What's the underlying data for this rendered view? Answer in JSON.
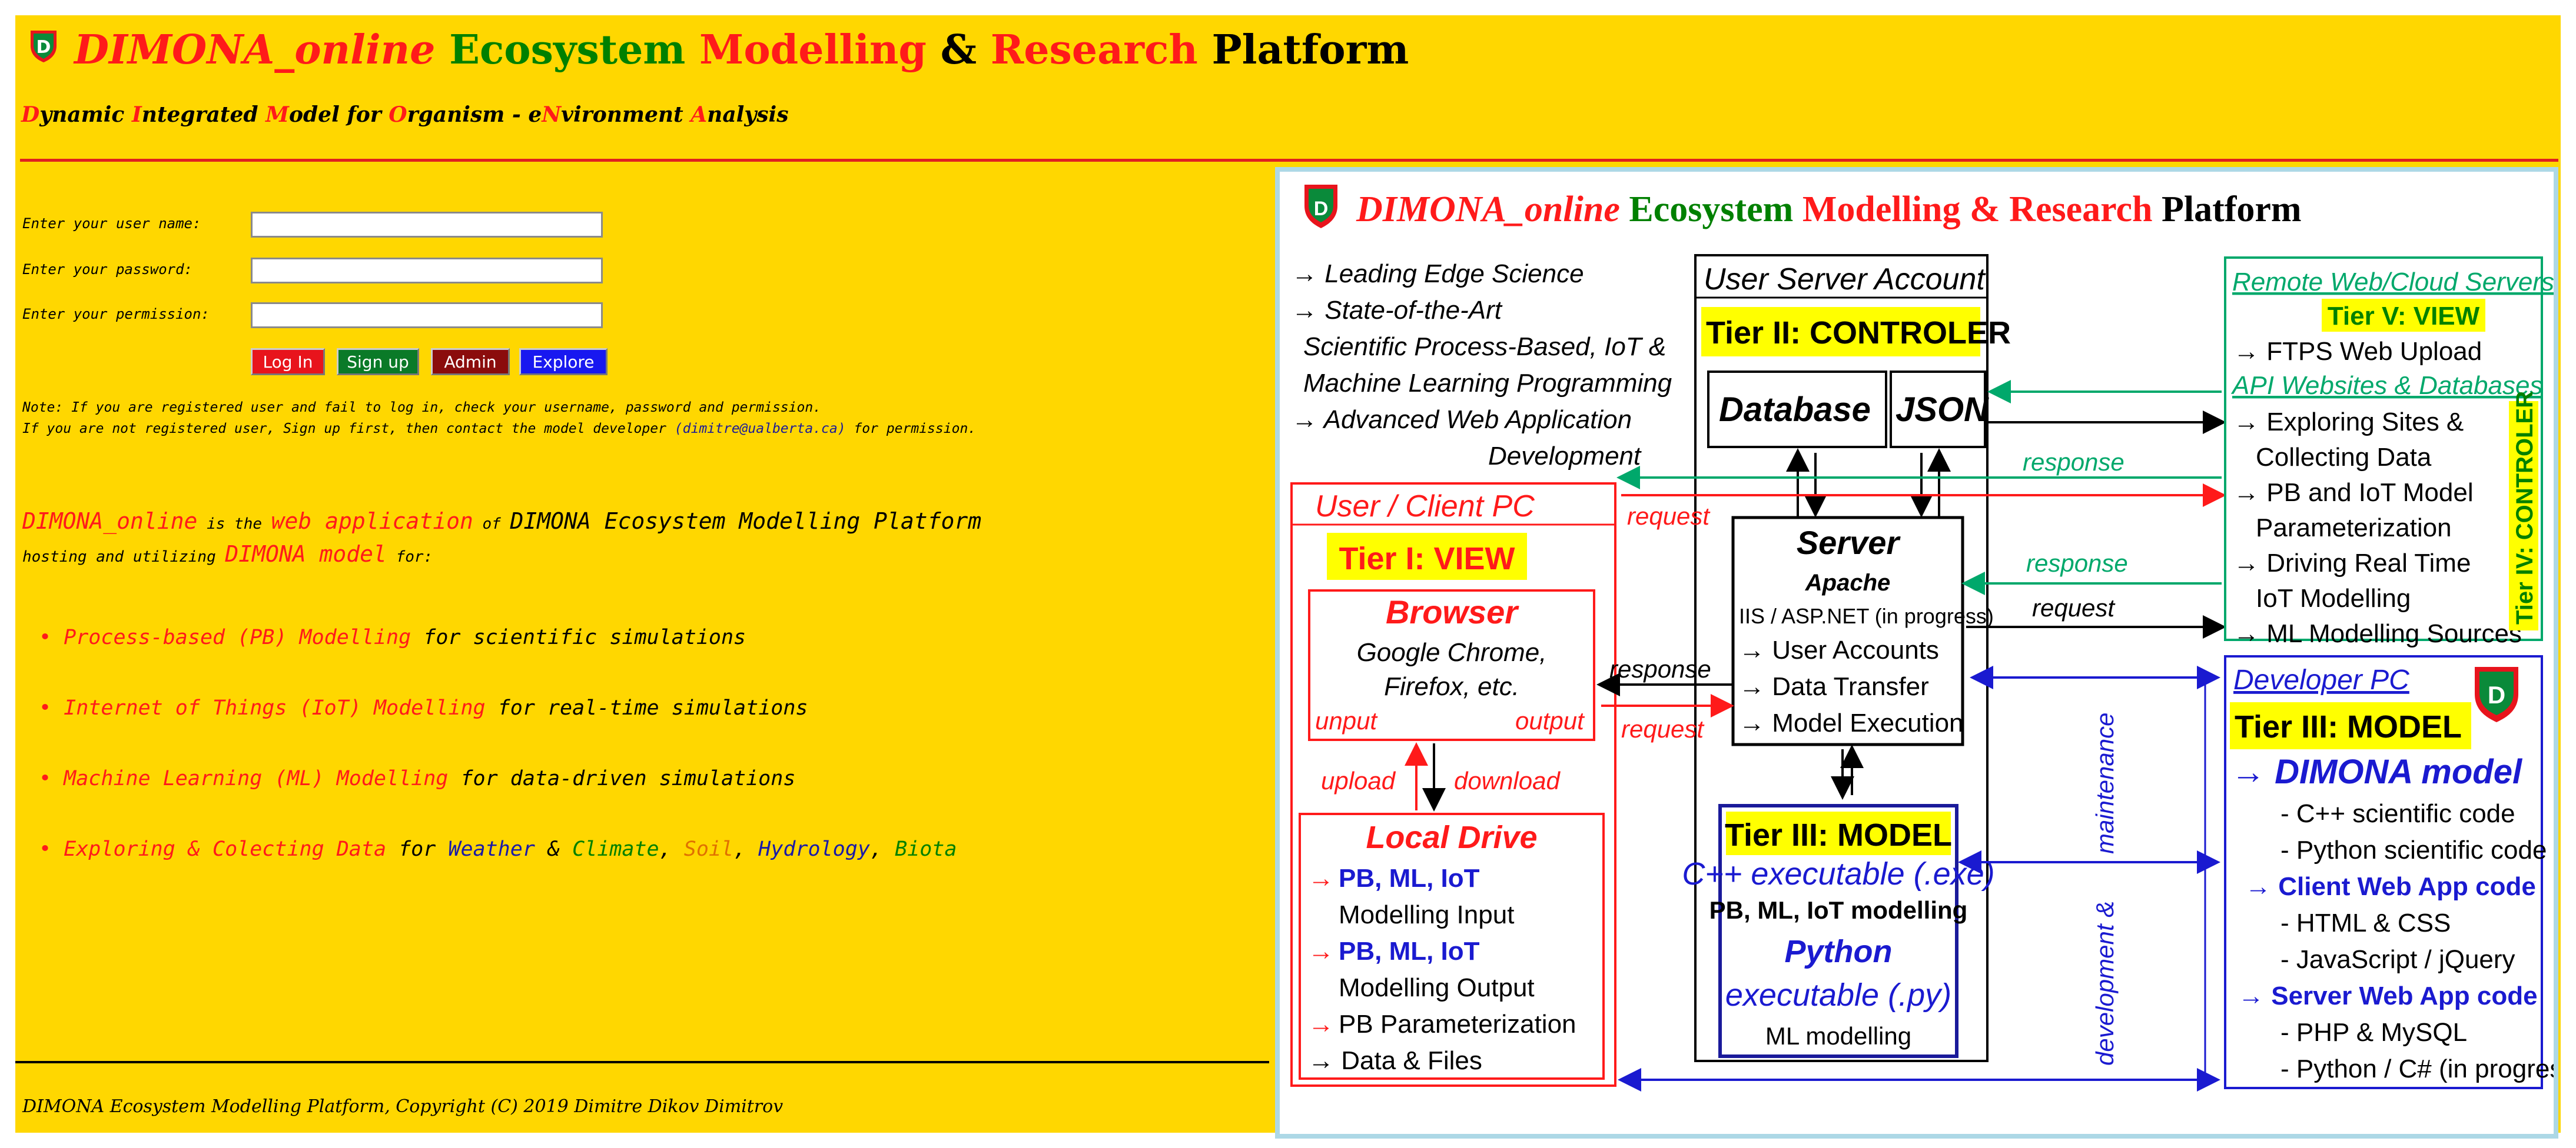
{
  "header": {
    "title": {
      "part1": "DIMONA_online",
      "part2": "Ecosystem",
      "part3": "Modelling",
      "part4": "&",
      "part5": "Research",
      "part6": "Platform"
    },
    "logo_letter": "D",
    "subtitle": [
      {
        "text": "D",
        "color": "red"
      },
      {
        "text": "ynamic ",
        "color": "black"
      },
      {
        "text": "I",
        "color": "red"
      },
      {
        "text": "ntegrated ",
        "color": "black"
      },
      {
        "text": "M",
        "color": "red"
      },
      {
        "text": "odel for ",
        "color": "black"
      },
      {
        "text": "O",
        "color": "red"
      },
      {
        "text": "rganism - e",
        "color": "black"
      },
      {
        "text": "N",
        "color": "red"
      },
      {
        "text": "vironment ",
        "color": "black"
      },
      {
        "text": "A",
        "color": "red"
      },
      {
        "text": "nalysis",
        "color": "black"
      }
    ]
  },
  "login": {
    "username_label": "Enter your user name:",
    "password_label": "Enter your password:",
    "permission_label": "Enter your permission:",
    "username_value": "",
    "password_value": "",
    "permission_value": "",
    "buttons": {
      "login": "Log In",
      "signup": "Sign up",
      "admin": "Admin",
      "explore": "Explore"
    },
    "note_line1": "Note: If you are registered user and fail to log in, check your username, password and permission.",
    "note_line2_pre": "If you are not registered user, Sign up first, then contact the model developer ",
    "note_email": "(dimitre@ualberta.ca)",
    "note_line2_post": " for permission."
  },
  "intro": {
    "app": "DIMONA_online",
    "is_the": " is the ",
    "webapp": "web application",
    "of": " of ",
    "platform": "DIMONA Ecosystem Modelling Platform",
    "hosting": "hosting and utilizing ",
    "model": "DIMONA model",
    "for": " for:"
  },
  "bullets": [
    {
      "head": "Process-based (PB) Modelling",
      "tail": " for scientific simulations"
    },
    {
      "head": "Internet of Things (IoT) Modelling",
      "tail": " for real-time simulations"
    },
    {
      "head": "Machine Learning (ML) Modelling",
      "tail": " for data-driven simulations"
    }
  ],
  "explore_bullet": {
    "head": "Exploring & Colecting Data",
    "for": " for ",
    "weather": "Weather",
    "amp": " & ",
    "climate": "Climate",
    "c1": ", ",
    "soil": "Soil",
    "c2": ", ",
    "hydrology": "Hydrology",
    "c3": ", ",
    "biota": "Biota"
  },
  "footer": "DIMONA Ecosystem Modelling Platform, Copyright (C) 2019 Dimitre Dikov Dimitrov",
  "diagram": {
    "title": {
      "part1": "DIMONA_online",
      "part2": "Ecosystem",
      "part3": "Modelling",
      "part4": "&",
      "part5": "Research",
      "part6": "Platform"
    },
    "features": [
      "→  Leading Edge Science",
      "→  State-of-the-Art",
      "Scientific Process-Based, IoT &",
      "Machine Learning Programming",
      "→  Advanced Web Application",
      "Development"
    ],
    "user_server_account": "User Server Account",
    "tier2": "Tier II: CONTROLER",
    "database": "Database",
    "json": "JSON",
    "server": "Server",
    "apache": "Apache",
    "iis": "IIS / ASP.NET (in progress)",
    "server_items": [
      "→ User Accounts",
      "→ Data Transfer",
      "→ Model Execution"
    ],
    "client_pc": "User / Client PC",
    "tier1": "Tier I: VIEW",
    "browser": "Browser",
    "browser_desc1": "Google Chrome,",
    "browser_desc2": "Firefox, etc.",
    "unput": "unput",
    "output": "output",
    "upload": "upload",
    "download": "download",
    "local_drive": "Local Drive",
    "local_items": [
      "PB, ML, IoT",
      "Modelling Input",
      "PB, ML, IoT",
      "Modelling Output",
      "PB Parameterization",
      "→ Data & Files"
    ],
    "tier3_center": "Tier III: MODEL",
    "cpp_exe": "C++ executable (.exe)",
    "pb_ml_iot_modelling": "PB, ML, IoT modelling",
    "python": "Python",
    "py_exe": "executable (.py)",
    "ml_modelling": "ML modelling",
    "remote": "Remote Web/Cloud Servers",
    "tier5": "Tier V: VIEW",
    "ftps": "→  FTPS Web Upload",
    "api": "API Websites & Databases",
    "remote_items": [
      "→  Exploring Sites &",
      "Collecting Data",
      "→  PB and IoT Model",
      "Parameterization",
      "→  Driving Real Time",
      "IoT Modelling",
      "→  ML Modelling Sources"
    ],
    "tier4": "Tier IV: CONTROLER",
    "dev_pc": "Developer PC",
    "tier3_dev": "Tier III: MODEL",
    "dimona_model": "→ DIMONA model",
    "dev_items": [
      "- C++ scientific code",
      "- Python scientific code",
      "→  Client Web App code",
      "- HTML & CSS",
      "- JavaScript / jQuery",
      "→ Server Web App code",
      "- PHP & MySQL",
      "- Python / C# (in progress)"
    ],
    "response": "response",
    "request": "request",
    "maintenance": "maintenance",
    "development": "development &"
  },
  "colors": {
    "background": "#ffd700",
    "red": "#ff1a1a",
    "green": "#008000",
    "navy": "#1a1aa8",
    "teal": "#00a86b",
    "btn_login": "#e8141c",
    "btn_signup": "#0a7a28",
    "btn_admin": "#8b0c0c",
    "btn_explore": "#1818f0"
  }
}
